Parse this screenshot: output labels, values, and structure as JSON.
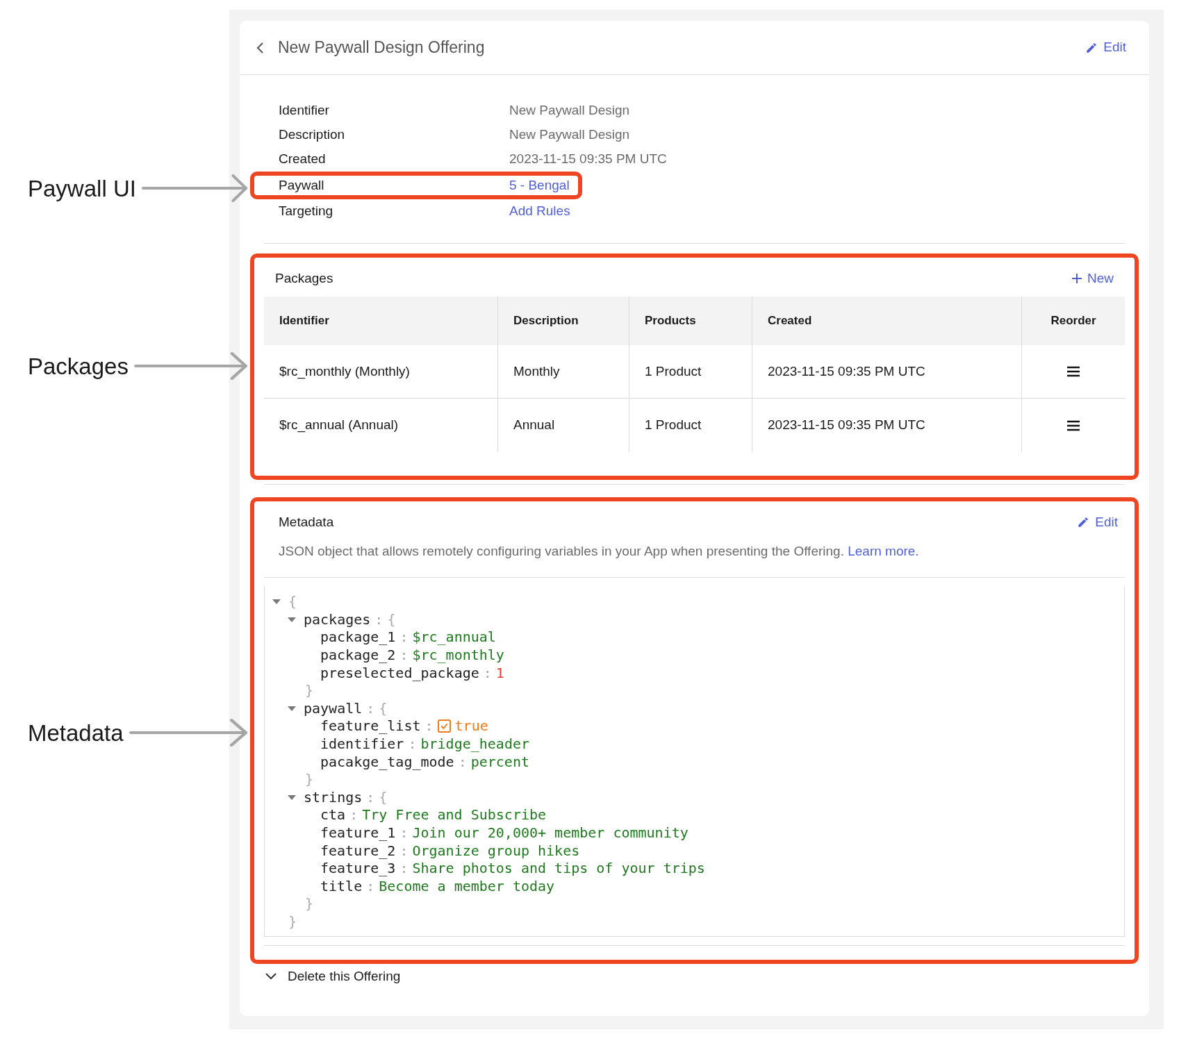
{
  "callouts": [
    {
      "label": "Paywall UI"
    },
    {
      "label": "Packages"
    },
    {
      "label": "Metadata"
    }
  ],
  "offering": {
    "title": "New Paywall Design Offering",
    "edit": "Edit"
  },
  "details": [
    {
      "label": "Identifier",
      "value": "New Paywall Design",
      "kind": "text",
      "highlighted": false
    },
    {
      "label": "Description",
      "value": "New Paywall Design",
      "kind": "text",
      "highlighted": false
    },
    {
      "label": "Created",
      "value": "2023-11-15 09:35 PM UTC",
      "kind": "text",
      "highlighted": false
    },
    {
      "label": "Paywall",
      "value": "5 - Bengal",
      "kind": "link",
      "highlighted": true
    },
    {
      "label": "Targeting",
      "value": "Add Rules",
      "kind": "link",
      "highlighted": false
    }
  ],
  "packages": {
    "title": "Packages",
    "new": "New",
    "highlighted": true,
    "columns": [
      "Identifier",
      "Description",
      "Products",
      "Created",
      "Reorder"
    ],
    "rows": [
      {
        "cells": [
          "$rc_monthly (Monthly)",
          "Monthly",
          "1 Product",
          "2023-11-15 09:35 PM UTC"
        ]
      },
      {
        "cells": [
          "$rc_annual (Annual)",
          "Annual",
          "1 Product",
          "2023-11-15 09:35 PM UTC"
        ]
      }
    ]
  },
  "metadata": {
    "title": "Metadata",
    "edit": "Edit",
    "highlighted": true,
    "description": "JSON object that allows remotely configuring variables in your App when presenting the Offering.",
    "learn_more": "Learn more.",
    "root": {
      "open": "{",
      "close": "}",
      "expanded": true,
      "children": [
        {
          "key": "packages",
          "sep": ":",
          "open": "{",
          "close": "}",
          "expanded": true,
          "children": [
            {
              "key": "package_1",
              "sep": ":",
              "kind": "string",
              "value": "$rc_annual"
            },
            {
              "key": "package_2",
              "sep": ":",
              "kind": "string",
              "value": "$rc_monthly"
            },
            {
              "key": "preselected_package",
              "sep": ":",
              "kind": "number",
              "value": "1"
            }
          ]
        },
        {
          "key": "paywall",
          "sep": ":",
          "open": "{",
          "close": "}",
          "expanded": true,
          "children": [
            {
              "key": "feature_list",
              "sep": ":",
              "kind": "boolean",
              "checked": true,
              "value": "true"
            },
            {
              "key": "identifier",
              "sep": ":",
              "kind": "string",
              "value": "bridge_header"
            },
            {
              "key": "pacakge_tag_mode",
              "sep": ":",
              "kind": "string",
              "value": "percent"
            }
          ]
        },
        {
          "key": "strings",
          "sep": ":",
          "open": "{",
          "close": "}",
          "expanded": true,
          "children": [
            {
              "key": "cta",
              "sep": ":",
              "kind": "string",
              "value": "Try Free and Subscribe"
            },
            {
              "key": "feature_1",
              "sep": ":",
              "kind": "string",
              "value": "Join our 20,000+ member community"
            },
            {
              "key": "feature_2",
              "sep": ":",
              "kind": "string",
              "value": "Organize group hikes"
            },
            {
              "key": "feature_3",
              "sep": ":",
              "kind": "string",
              "value": "Share photos and tips of your trips"
            },
            {
              "key": "title",
              "sep": ":",
              "kind": "string",
              "value": "Become a member today"
            }
          ]
        }
      ]
    }
  },
  "delete": {
    "label": "Delete this Offering"
  }
}
